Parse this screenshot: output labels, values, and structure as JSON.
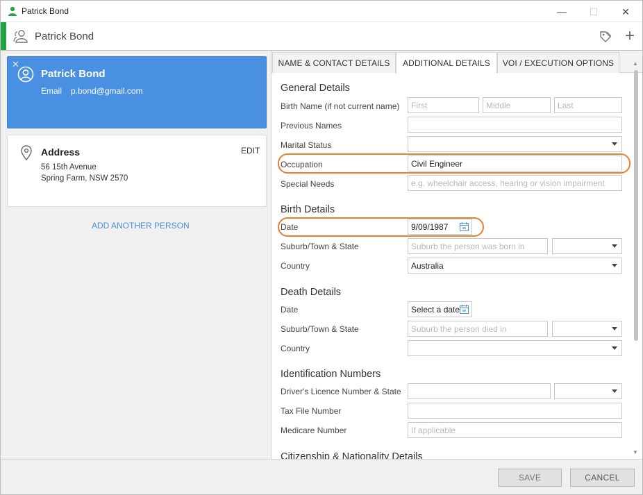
{
  "window": {
    "title": "Patrick Bond",
    "min_glyph": "—",
    "max_glyph": "☐",
    "close_glyph": "✕"
  },
  "header": {
    "name": "Patrick Bond",
    "accent_color": "#1fa543",
    "icons": [
      "person-group-icon",
      "tag-icon",
      "plus-icon"
    ]
  },
  "person_card": {
    "close_glyph": "✕",
    "name": "Patrick Bond",
    "email_label": "Email",
    "email_value": "p.bond@gmail.com",
    "bg_color": "#4a90e2"
  },
  "address_card": {
    "title": "Address",
    "edit_label": "EDIT",
    "line1": "56 15th Avenue",
    "line2": "Spring Farm, NSW 2570"
  },
  "add_another_label": "ADD ANOTHER PERSON",
  "tabs": [
    {
      "label": "NAME & CONTACT DETAILS",
      "active": false
    },
    {
      "label": "ADDITIONAL DETAILS",
      "active": true
    },
    {
      "label": "VOI / EXECUTION OPTIONS",
      "active": false
    }
  ],
  "general": {
    "title": "General Details",
    "birth_name_label": "Birth Name (if not current name)",
    "first_placeholder": "First",
    "middle_placeholder": "Middle",
    "last_placeholder": "Last",
    "previous_names_label": "Previous Names",
    "previous_names_value": "",
    "marital_status_label": "Marital Status",
    "marital_status_value": "",
    "occupation_label": "Occupation",
    "occupation_value": "Civil Engineer",
    "special_needs_label": "Special Needs",
    "special_needs_placeholder": "e.g. wheelchair access, hearing or vision impairment"
  },
  "birth": {
    "title": "Birth Details",
    "date_label": "Date",
    "date_value": "9/09/1987",
    "suburb_label": "Suburb/Town & State",
    "suburb_placeholder": "Suburb the person was born in",
    "state_value": "",
    "country_label": "Country",
    "country_value": "Australia"
  },
  "death": {
    "title": "Death Details",
    "date_label": "Date",
    "date_value": "Select a date",
    "suburb_label": "Suburb/Town & State",
    "suburb_placeholder": "Suburb the person died in",
    "state_value": "",
    "country_label": "Country",
    "country_value": ""
  },
  "identification": {
    "title": "Identification Numbers",
    "licence_label": "Driver's Licence Number & State",
    "licence_value": "",
    "licence_state_value": "",
    "tfn_label": "Tax File Number",
    "tfn_value": "",
    "medicare_label": "Medicare Number",
    "medicare_placeholder": "If applicable"
  },
  "citizenship": {
    "title": "Citizenship & Nationality Details"
  },
  "footer": {
    "save_label": "SAVE",
    "cancel_label": "CANCEL"
  },
  "highlight_color": "#e8812f"
}
